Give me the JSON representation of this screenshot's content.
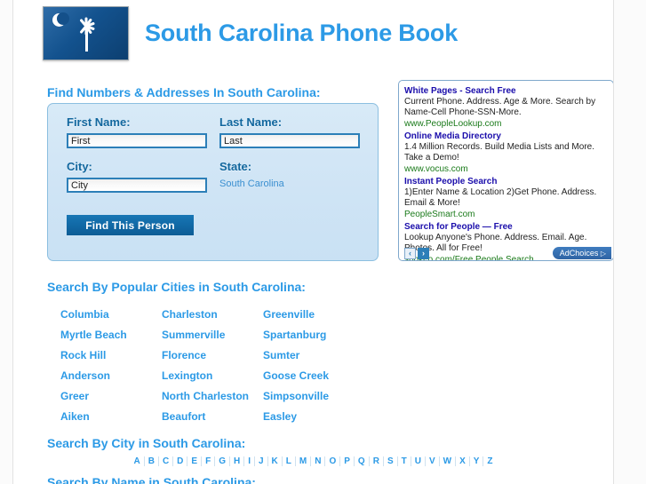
{
  "site": {
    "title": "South Carolina Phone Book",
    "flag_icon": "south-carolina-flag-icon"
  },
  "headings": {
    "find": "Find Numbers & Addresses In South Carolina:",
    "popular_cities": "Search By Popular Cities in South Carolina:",
    "search_by_city": "Search By City in South Carolina:",
    "search_by_name": "Search By Name in South Carolina:"
  },
  "form": {
    "first_name": {
      "label": "First Name:",
      "value": "First",
      "placeholder": "First"
    },
    "last_name": {
      "label": "Last Name:",
      "value": "Last",
      "placeholder": "Last"
    },
    "city": {
      "label": "City:",
      "value": "City",
      "placeholder": "City"
    },
    "state": {
      "label": "State:",
      "value": "South Carolina"
    },
    "submit_label": "Find This Person"
  },
  "ads": {
    "items": [
      {
        "title": "White Pages - Search Free",
        "description": "Current Phone. Address. Age & More. Search by Name-Cell Phone-SSN-More.",
        "url": "www.PeopleLookup.com"
      },
      {
        "title": "Online Media Directory",
        "description": "1.4 Million Records. Build Media Lists and More. Take a Demo!",
        "url": "www.vocus.com"
      },
      {
        "title": "Instant People Search",
        "description": "1)Enter Name & Location 2)Get Phone. Address. Email & More!",
        "url": "PeopleSmart.com"
      },
      {
        "title": "Search for People — Free",
        "description": "Lookup Anyone's Phone. Address. Email. Age. Photos. All for Free!",
        "url": "spokeo.com/Free.People.Search"
      }
    ],
    "prev_label": "‹",
    "next_label": "›",
    "adchoices_label": "AdChoices",
    "adchoices_glyph": "▷"
  },
  "popular_cities": [
    [
      "Columbia",
      "Charleston",
      "Greenville"
    ],
    [
      "Myrtle Beach",
      "Summerville",
      "Spartanburg"
    ],
    [
      "Rock Hill",
      "Florence",
      "Sumter"
    ],
    [
      "Anderson",
      "Lexington",
      "Goose Creek"
    ],
    [
      "Greer",
      "North Charleston",
      "Simpsonville"
    ],
    [
      "Aiken",
      "Beaufort",
      "Easley"
    ]
  ],
  "alphabet": [
    "A",
    "B",
    "C",
    "D",
    "E",
    "F",
    "G",
    "H",
    "I",
    "J",
    "K",
    "L",
    "M",
    "N",
    "O",
    "P",
    "Q",
    "R",
    "S",
    "T",
    "U",
    "V",
    "W",
    "X",
    "Y",
    "Z"
  ],
  "colors": {
    "accent_blue": "#2c9ae6",
    "label_blue": "#12679e",
    "button_blue": "#1169a6",
    "ad_title_blue": "#1a0dab",
    "ad_url_green": "#1a7a1a",
    "form_bg": "#cfe4f5",
    "page_bg": "#ffffff"
  }
}
